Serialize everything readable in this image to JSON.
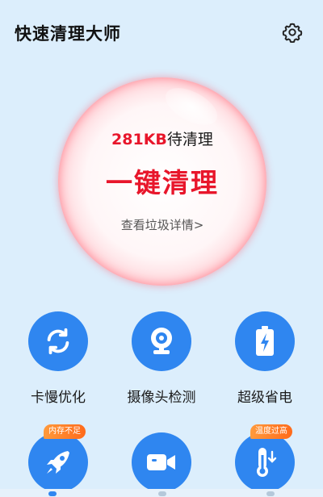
{
  "header": {
    "title": "快速清理大师",
    "settings_icon": "gear-icon"
  },
  "bubble": {
    "size_value": "281KB",
    "size_suffix": "待清理",
    "action": "一键清理",
    "detail_link": "查看垃圾详情>"
  },
  "features": [
    {
      "label": "卡慢优化",
      "icon": "refresh-icon"
    },
    {
      "label": "摄像头检测",
      "icon": "webcam-icon"
    },
    {
      "label": "超级省电",
      "icon": "battery-bolt-icon"
    },
    {
      "label": "",
      "icon": "rocket-icon",
      "badge": "内存不足"
    },
    {
      "label": "",
      "icon": "video-camera-icon"
    },
    {
      "label": "",
      "icon": "thermometer-icon",
      "badge": "温度过高"
    }
  ],
  "colors": {
    "accent": "#2f86f0",
    "alert": "#e8162b",
    "badge": "#ff7a22",
    "background": "#dceefc"
  }
}
